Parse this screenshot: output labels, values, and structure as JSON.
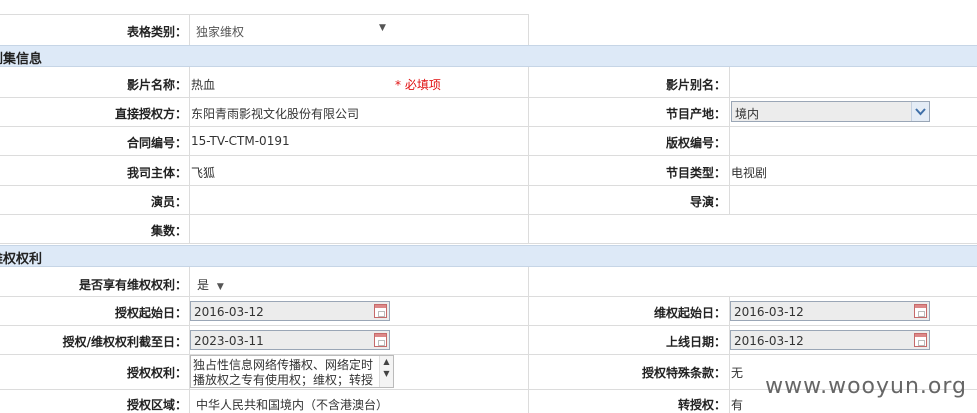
{
  "form_type": {
    "label": "表格类别：",
    "value": "独家维权",
    "arrow": "▼"
  },
  "section_drama": {
    "title": "剧集信息"
  },
  "film_name": {
    "label": "影片名称：",
    "value": "热血",
    "required_note": "* 必填项"
  },
  "film_alias": {
    "label": "影片别名：",
    "value": ""
  },
  "direct_licensor": {
    "label": "直接授权方：",
    "value": "东阳青雨影视文化股份有限公司"
  },
  "origin": {
    "label": "节目产地：",
    "value": "境内"
  },
  "contract_no": {
    "label": "合同编号：",
    "value": "15-TV-CTM-0191"
  },
  "copyright_no": {
    "label": "版权编号：",
    "value": ""
  },
  "our_entity": {
    "label": "我司主体：",
    "value": "飞狐"
  },
  "program_type": {
    "label": "节目类型：",
    "value": "电视剧"
  },
  "actors": {
    "label": "演员：",
    "value": ""
  },
  "director": {
    "label": "导演：",
    "value": ""
  },
  "episodes": {
    "label": "集数：",
    "value": ""
  },
  "section_rights": {
    "title": "维权权利"
  },
  "has_rights": {
    "label": "是否享有维权权利：",
    "value": "是",
    "arrow": "▼"
  },
  "license_start": {
    "label": "授权起始日：",
    "value": "2016-03-12"
  },
  "rights_start": {
    "label": "维权起始日：",
    "value": "2016-03-12"
  },
  "license_end": {
    "label": "授权/维权权利截至日：",
    "value": "2023-03-11"
  },
  "online_date": {
    "label": "上线日期：",
    "value": "2016-03-12"
  },
  "license_rights": {
    "label": "授权权利：",
    "value": "独占性信息网络传播权、网络定时播放权之专有使用权；维权；转授"
  },
  "special_terms": {
    "label": "授权特殊条款：",
    "value": "无"
  },
  "license_region": {
    "label": "授权区域：",
    "value": "中华人民共和国境内（不含港澳台）"
  },
  "sublicense": {
    "label": "转授权：",
    "value": "有"
  },
  "watermark": "www.wooyun.org"
}
